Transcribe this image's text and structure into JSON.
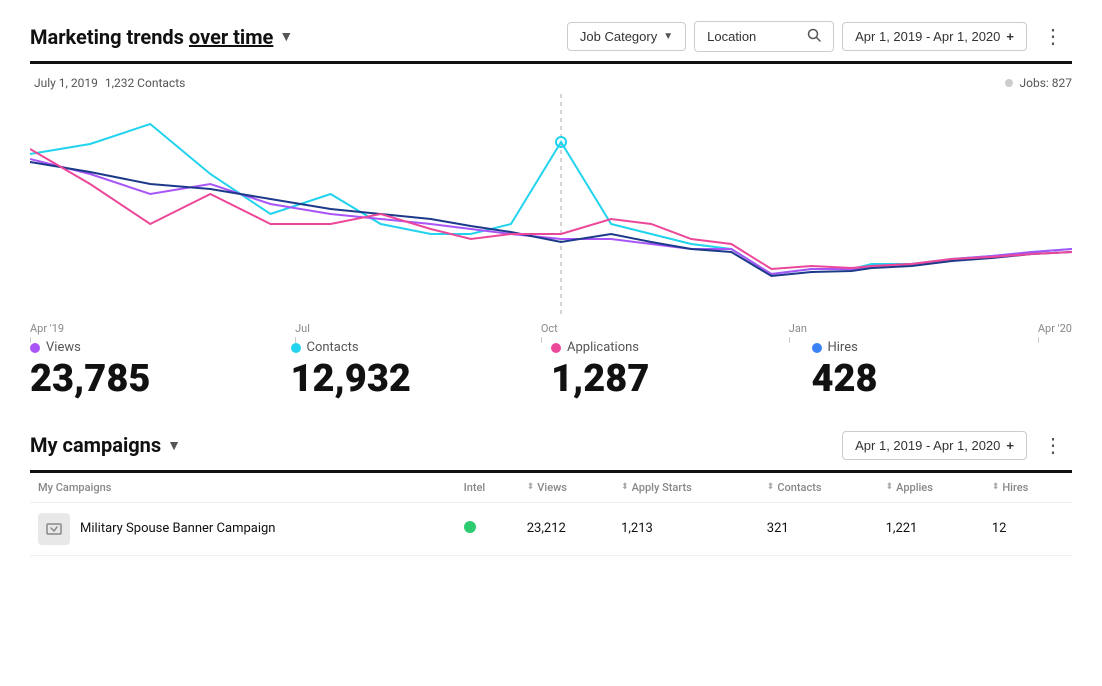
{
  "header": {
    "title_prefix": "Marketing trends ",
    "title_emphasis": "over time",
    "title_suffix": "",
    "dropdown_chevron": "▼",
    "more_dots": "⋮"
  },
  "filters": {
    "job_category_label": "Job Category",
    "job_category_chevron": "▼",
    "location_label": "Location",
    "location_placeholder": "Location",
    "date_range": "Apr 1, 2019 - Apr 1, 2020",
    "date_range_plus": "+",
    "more_dots": "⋮"
  },
  "chart": {
    "date_label": "July 1, 2019",
    "contacts_count": "1,232 Contacts",
    "jobs_label": "Jobs: 827",
    "x_axis": [
      "Apr '19",
      "Jul",
      "Oct",
      "Jan",
      "Apr '20"
    ]
  },
  "metrics": [
    {
      "id": "views",
      "label": "Views",
      "value": "23,785",
      "color": "#a855f7"
    },
    {
      "id": "contacts",
      "label": "Contacts",
      "value": "12,932",
      "color": "#22d3ee"
    },
    {
      "id": "applications",
      "label": "Applications",
      "value": "1,287",
      "color": "#ec4899"
    },
    {
      "id": "hires",
      "label": "Hires",
      "value": "428",
      "color": "#3b82f6"
    }
  ],
  "campaigns": {
    "title_prefix": "My campaigns",
    "date_range": "Apr 1, 2019 - Apr 1, 2020",
    "date_range_plus": "+",
    "more_dots": "⋮",
    "columns": [
      "My Campaigns",
      "Intel",
      "Views",
      "Apply Starts",
      "Contacts",
      "Applies",
      "Hires"
    ],
    "rows": [
      {
        "name": "Military Spouse Banner Campaign",
        "icon": "🖼",
        "intel_status": "green",
        "views": "23,212",
        "apply_starts": "1,213",
        "contacts": "321",
        "applies": "1,221",
        "hires": "12"
      }
    ]
  }
}
